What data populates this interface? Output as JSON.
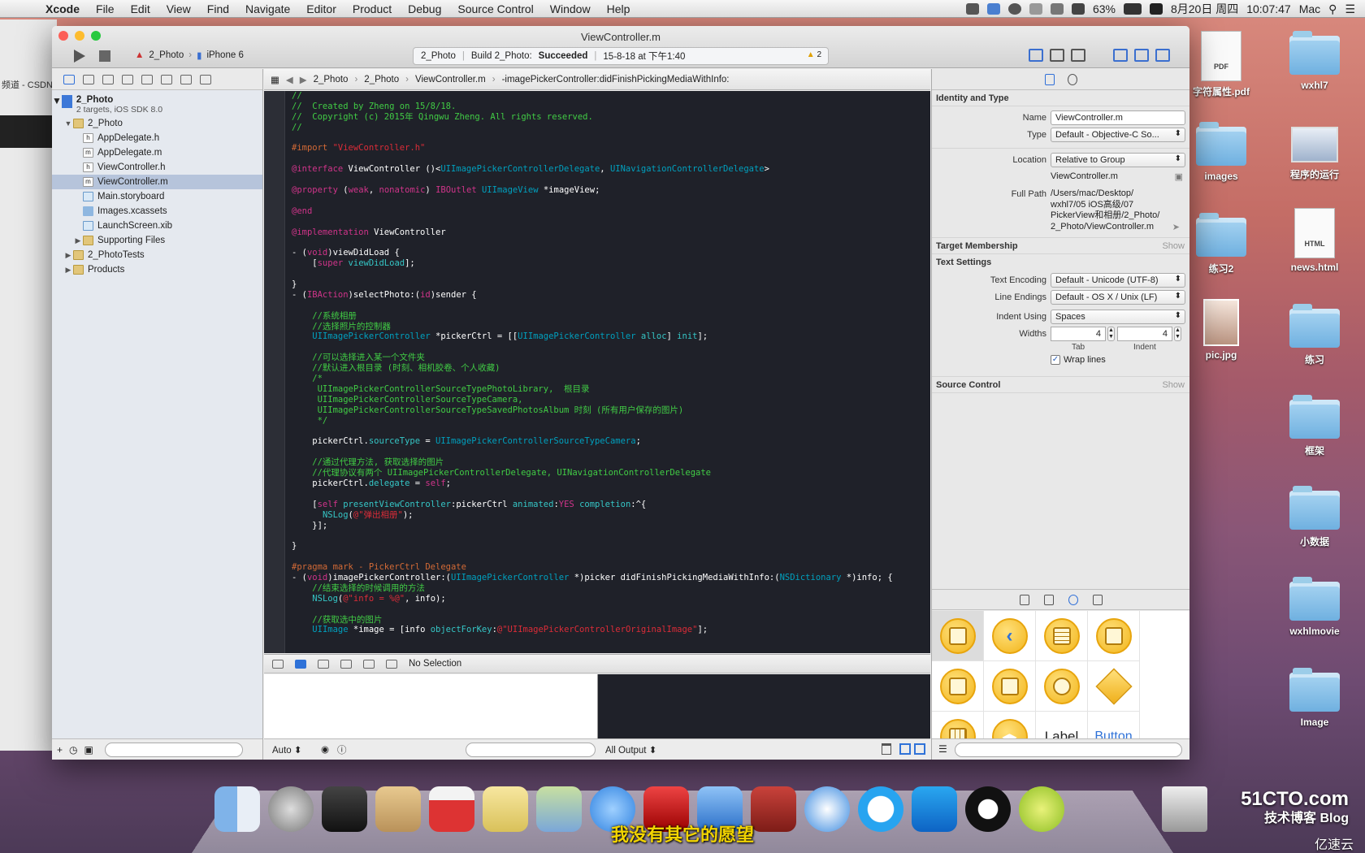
{
  "menubar": {
    "items": [
      "Xcode",
      "File",
      "Edit",
      "View",
      "Find",
      "Navigate",
      "Editor",
      "Product",
      "Debug",
      "Source Control",
      "Window",
      "Help"
    ],
    "battery": "63%",
    "date": "8月20日 周四",
    "time": "10:07:47",
    "user": "Mac"
  },
  "desktop": {
    "items": [
      "字符属性.pdf",
      "wxhl7",
      "images",
      "程序的运行",
      "练习2",
      "news.html",
      "pic.jpg",
      "练习",
      "框架",
      "小数据",
      "wxhlmovie",
      "Image"
    ],
    "pdf_badge": "PDF",
    "html_badge": "HTML"
  },
  "browser": {
    "tab_text": "频道 - CSDN"
  },
  "window": {
    "title": "ViewController.m",
    "scheme": "2_Photo",
    "device": "iPhone 6",
    "activity": {
      "project": "2_Photo",
      "build_prefix": "Build 2_Photo:",
      "build_status": "Succeeded",
      "time": "15-8-18 at 下午1:40",
      "warnings": "2"
    }
  },
  "navigator": {
    "project": {
      "name": "2_Photo",
      "detail": "2 targets, iOS SDK 8.0"
    },
    "items": [
      {
        "label": "2_Photo",
        "kind": "folder"
      },
      {
        "label": "AppDelegate.h",
        "kind": "h"
      },
      {
        "label": "AppDelegate.m",
        "kind": "m"
      },
      {
        "label": "ViewController.h",
        "kind": "h"
      },
      {
        "label": "ViewController.m",
        "kind": "m"
      },
      {
        "label": "Main.storyboard",
        "kind": "sb"
      },
      {
        "label": "Images.xcassets",
        "kind": "xc"
      },
      {
        "label": "LaunchScreen.xib",
        "kind": "sb"
      },
      {
        "label": "Supporting Files",
        "kind": "folder"
      },
      {
        "label": "2_PhotoTests",
        "kind": "folder"
      },
      {
        "label": "Products",
        "kind": "folder"
      }
    ]
  },
  "jumpbar": [
    "2_Photo",
    "2_Photo",
    "ViewController.m",
    "-imagePickerController:didFinishPickingMediaWithInfo:"
  ],
  "debug": {
    "selection": "No Selection",
    "auto": "Auto ⬍",
    "all_output": "All Output ⬍"
  },
  "inspector": {
    "identity_header": "Identity and Type",
    "name_label": "Name",
    "name_value": "ViewController.m",
    "type_label": "Type",
    "type_value": "Default - Objective-C So...",
    "location_label": "Location",
    "location_value": "Relative to Group",
    "location_file": "ViewController.m",
    "fullpath_label": "Full Path",
    "fullpath_lines": [
      "/Users/mac/Desktop/",
      "wxhl7/05 iOS高级/07",
      "PickerView和相册/2_Photo/",
      "2_Photo/ViewController.m"
    ],
    "target_header": "Target Membership",
    "text_header": "Text Settings",
    "show": "Show",
    "encoding_label": "Text Encoding",
    "encoding_value": "Default - Unicode (UTF-8)",
    "endings_label": "Line Endings",
    "endings_value": "Default - OS X / Unix (LF)",
    "indent_label": "Indent Using",
    "indent_value": "Spaces",
    "widths_label": "Widths",
    "tab_value": "4",
    "indent_width_value": "4",
    "tab_label": "Tab",
    "indent_sub_label": "Indent",
    "wrap_label": "Wrap lines",
    "source_header": "Source Control",
    "library_label": "Label",
    "library_button": "Button"
  },
  "code_lines": [
    [
      [
        "c",
        "//"
      ]
    ],
    [
      [
        "c",
        "//  Created by Zheng on 15/8/18."
      ]
    ],
    [
      [
        "c",
        "//  Copyright (c) 2015年 Qingwu Zheng. All rights reserved."
      ]
    ],
    [
      [
        "c",
        "//"
      ]
    ],
    [],
    [
      [
        "p",
        "#import "
      ],
      [
        "s",
        "\"ViewController.h\""
      ]
    ],
    [],
    [
      [
        "k",
        "@interface"
      ],
      [
        "w",
        " ViewController ()<"
      ],
      [
        "t",
        "UIImagePickerControllerDelegate"
      ],
      [
        "w",
        ", "
      ],
      [
        "t",
        "UINavigationControllerDelegate"
      ],
      [
        "w",
        ">"
      ]
    ],
    [],
    [
      [
        "k",
        "@property"
      ],
      [
        "w",
        " ("
      ],
      [
        "k",
        "weak"
      ],
      [
        "w",
        ", "
      ],
      [
        "k",
        "nonatomic"
      ],
      [
        "w",
        ") "
      ],
      [
        "k",
        "IBOutlet"
      ],
      [
        "w",
        " "
      ],
      [
        "t",
        "UIImageView"
      ],
      [
        "w",
        " *imageView;"
      ]
    ],
    [],
    [
      [
        "k",
        "@end"
      ]
    ],
    [],
    [
      [
        "k",
        "@implementation"
      ],
      [
        "w",
        " ViewController"
      ]
    ],
    [],
    [
      [
        "w",
        "- ("
      ],
      [
        "k",
        "void"
      ],
      [
        "w",
        ")viewDidLoad {"
      ]
    ],
    [
      [
        "w",
        "    ["
      ],
      [
        "k",
        "super"
      ],
      [
        "w",
        " "
      ],
      [
        "m",
        "viewDidLoad"
      ],
      [
        "w",
        "];"
      ]
    ],
    [],
    [
      [
        "w",
        "}"
      ]
    ],
    [
      [
        "w",
        "- ("
      ],
      [
        "k",
        "IBAction"
      ],
      [
        "w",
        ")selectPhoto:("
      ],
      [
        "k",
        "id"
      ],
      [
        "w",
        ")sender {"
      ]
    ],
    [],
    [
      [
        "c",
        "    //系统相册"
      ]
    ],
    [
      [
        "c",
        "    //选择照片的控制器"
      ]
    ],
    [
      [
        "w",
        "    "
      ],
      [
        "t",
        "UIImagePickerController"
      ],
      [
        "w",
        " *pickerCtrl = [["
      ],
      [
        "t",
        "UIImagePickerController"
      ],
      [
        "w",
        " "
      ],
      [
        "m",
        "alloc"
      ],
      [
        "w",
        "] "
      ],
      [
        "m",
        "init"
      ],
      [
        "w",
        "];"
      ]
    ],
    [],
    [
      [
        "c",
        "    //可以选择进入某一个文件夹"
      ]
    ],
    [
      [
        "c",
        "    //默认进入根目录 (时刻、相机胶卷、个人收藏)"
      ]
    ],
    [
      [
        "c",
        "    /*"
      ]
    ],
    [
      [
        "c",
        "     UIImagePickerControllerSourceTypePhotoLibrary,  根目录"
      ]
    ],
    [
      [
        "c",
        "     UIImagePickerControllerSourceTypeCamera,"
      ]
    ],
    [
      [
        "c",
        "     UIImagePickerControllerSourceTypeSavedPhotosAlbum 时刻 (所有用户保存的图片)"
      ]
    ],
    [
      [
        "c",
        "     */"
      ]
    ],
    [],
    [
      [
        "w",
        "    pickerCtrl."
      ],
      [
        "m",
        "sourceType"
      ],
      [
        "w",
        " = "
      ],
      [
        "t",
        "UIImagePickerControllerSourceTypeCamera"
      ],
      [
        "w",
        ";"
      ]
    ],
    [],
    [
      [
        "c",
        "    //通过代理方法, 获取选择的图片"
      ]
    ],
    [
      [
        "c",
        "    //代理协议有两个 UIImagePickerControllerDelegate, UINavigationControllerDelegate"
      ]
    ],
    [
      [
        "w",
        "    pickerCtrl."
      ],
      [
        "m",
        "delegate"
      ],
      [
        "w",
        " = "
      ],
      [
        "k",
        "self"
      ],
      [
        "w",
        ";"
      ]
    ],
    [],
    [
      [
        "w",
        "    ["
      ],
      [
        "k",
        "self"
      ],
      [
        "w",
        " "
      ],
      [
        "m",
        "presentViewController"
      ],
      [
        "w",
        ":pickerCtrl "
      ],
      [
        "m",
        "animated"
      ],
      [
        "w",
        ":"
      ],
      [
        "k",
        "YES"
      ],
      [
        "w",
        " "
      ],
      [
        "m",
        "completion"
      ],
      [
        "w",
        ":^{"
      ]
    ],
    [
      [
        "w",
        "      "
      ],
      [
        "m",
        "NSLog"
      ],
      [
        "w",
        "("
      ],
      [
        "s",
        "@\"弹出相册\""
      ],
      [
        "w",
        ");"
      ]
    ],
    [
      [
        "w",
        "    }];"
      ]
    ],
    [],
    [
      [
        "w",
        "}"
      ]
    ],
    [],
    [
      [
        "p",
        "#pragma mark - PickerCtrl Delegate"
      ]
    ],
    [
      [
        "w",
        "- ("
      ],
      [
        "k",
        "void"
      ],
      [
        "w",
        ")imagePickerController:("
      ],
      [
        "t",
        "UIImagePickerController"
      ],
      [
        "w",
        " *)picker didFinishPickingMediaWithInfo:("
      ],
      [
        "t",
        "NSDictionary"
      ],
      [
        "w",
        " *)info; {"
      ]
    ],
    [
      [
        "c",
        "    //结束选择的时候调用的方法"
      ]
    ],
    [
      [
        "w",
        "    "
      ],
      [
        "m",
        "NSLog"
      ],
      [
        "w",
        "("
      ],
      [
        "s",
        "@\"info = %@\""
      ],
      [
        "w",
        ", info);"
      ]
    ],
    [],
    [
      [
        "c",
        "    //获取选中的图片"
      ]
    ],
    [
      [
        "w",
        "    "
      ],
      [
        "t",
        "UIImage"
      ],
      [
        "w",
        " *image = [info "
      ],
      [
        "m",
        "objectForKey"
      ],
      [
        "w",
        ":"
      ],
      [
        "s",
        "@\"UIImagePickerControllerOriginalImage\""
      ],
      [
        "w",
        "];"
      ]
    ]
  ],
  "subtitle": "我没有其它的愿望",
  "watermark": {
    "line1": "51CTO.com",
    "line2": "技术博客  Blog",
    "line3": "亿速云"
  }
}
